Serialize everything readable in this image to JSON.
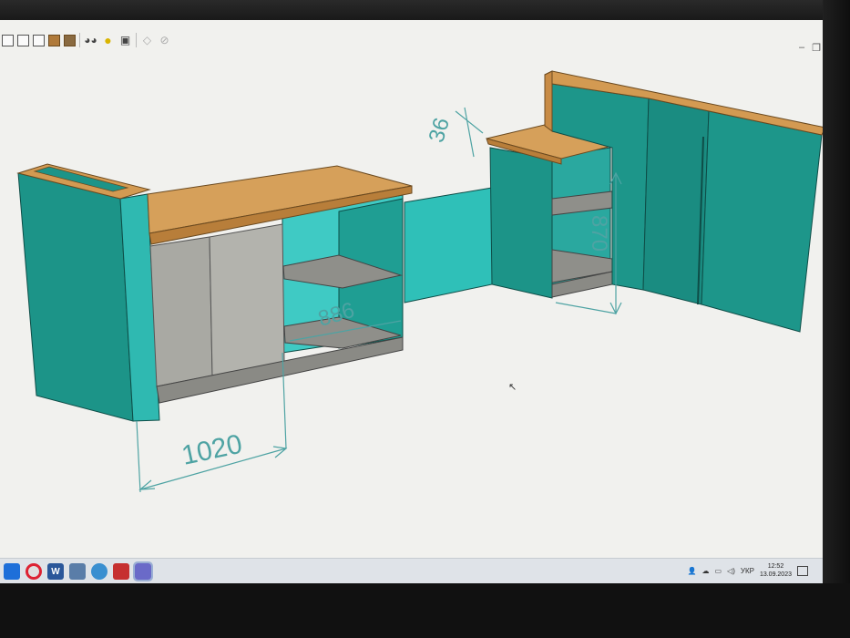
{
  "toolbar": {
    "icons": [
      "cube-wire-icon",
      "cube-hidden-icon",
      "cube-shade-icon",
      "cube-solid-icon",
      "cube-texture-icon",
      "glasses-icon",
      "bulb-icon",
      "render-icon",
      "section-icon",
      "measure-icon"
    ]
  },
  "dimensions": {
    "width_left": "1020",
    "depth_shelf": "886",
    "height_right": "870",
    "thickness_top": "36"
  },
  "taskbar": {
    "language": "УКР",
    "time": "12:52",
    "date": "13.09.2023"
  },
  "colors": {
    "teal": "#1f9e93",
    "teal_dark": "#167a72",
    "teal_light": "#3cc9c2",
    "wood": "#d49a4f",
    "wood_dark": "#9c6a2c",
    "gray_door": "#a8a8a2",
    "dimension_line": "#4ea3a3"
  }
}
